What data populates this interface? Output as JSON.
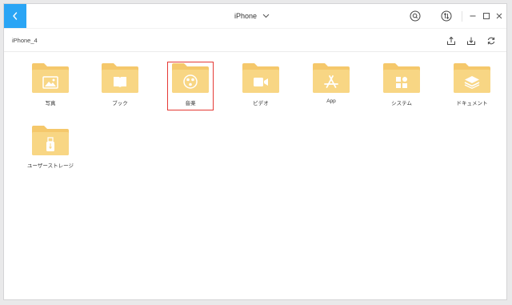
{
  "titlebar": {
    "device_name": "iPhone"
  },
  "toolbar": {
    "breadcrumb": "iPhone_4"
  },
  "folders": [
    {
      "label": "写真",
      "icon": "image-icon"
    },
    {
      "label": "ブック",
      "icon": "book-icon"
    },
    {
      "label": "音楽",
      "icon": "music-icon"
    },
    {
      "label": "ビデオ",
      "icon": "video-icon"
    },
    {
      "label": "App",
      "icon": "app-store-icon"
    },
    {
      "label": "システム",
      "icon": "system-icon"
    },
    {
      "label": "ドキュメント",
      "icon": "layers-icon"
    },
    {
      "label": "ユーザーストレージ",
      "icon": "usb-icon"
    }
  ],
  "selected_folder": "音楽",
  "colors": {
    "accent": "#2aa5f5",
    "folder_back": "#f5c86b",
    "folder_front": "#f8d684",
    "selection": "#e53935"
  }
}
